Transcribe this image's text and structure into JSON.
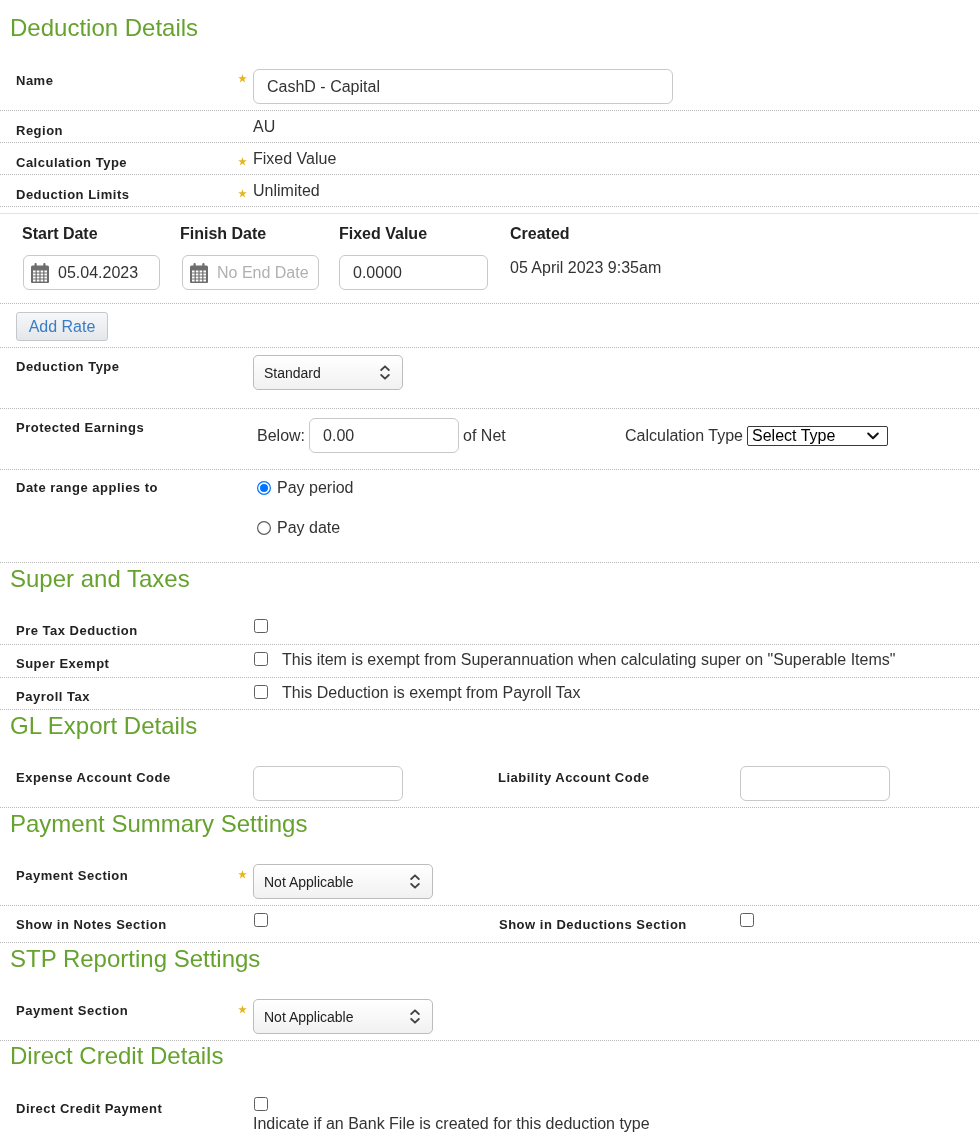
{
  "deduction_details": {
    "title": "Deduction Details",
    "fields": [
      {
        "label": "Name",
        "required": true,
        "kind": "input",
        "value": "CashD - Capital"
      },
      {
        "label": "Region",
        "required": false,
        "kind": "text",
        "value": "AU"
      },
      {
        "label": "Calculation Type",
        "required": true,
        "kind": "text",
        "value": "Fixed Value"
      },
      {
        "label": "Deduction Limits",
        "required": true,
        "kind": "text",
        "value": "Unlimited"
      }
    ],
    "rates": {
      "columns": [
        "Start Date",
        "Finish Date",
        "Fixed Value",
        "Created"
      ],
      "row": {
        "start_date": {
          "value": "05.04.2023"
        },
        "finish_date": {
          "placeholder": "No End Date"
        },
        "fixed_value": {
          "value": "0.0000"
        },
        "created": "05 April 2023 9:35am"
      }
    },
    "add_rate_button": "Add Rate",
    "deduction_type": {
      "label": "Deduction Type",
      "value": "Standard"
    },
    "protected_earnings": {
      "label": "Protected Earnings",
      "prefix": "Below:",
      "value": "0.00",
      "suffix": "of Net",
      "calculation_type": {
        "label": "Calculation Type",
        "value": "Select Type"
      }
    },
    "date_range": {
      "label": "Date range applies to",
      "options": [
        {
          "label": "Pay period",
          "selected": true
        },
        {
          "label": "Pay date",
          "selected": false
        }
      ]
    }
  },
  "super_and_taxes": {
    "title": "Super and Taxes",
    "items": [
      {
        "label": "Pre Tax Deduction",
        "checked": false
      },
      {
        "label": "Super Exempt",
        "checked": false,
        "description": "This item is exempt from Superannuation when calculating super on \"Superable Items\""
      },
      {
        "label": "Payroll Tax",
        "checked": false,
        "description": "This Deduction is exempt from Payroll Tax"
      }
    ]
  },
  "gl_export_details": {
    "title": "GL Export Details",
    "fields": [
      {
        "label": "Expense Account Code"
      },
      {
        "label": "Liability Account Code"
      }
    ]
  },
  "payment_summary_settings": {
    "title": "Payment Summary Settings",
    "payment_section": {
      "label": "Payment Section",
      "required": true,
      "value": "Not Applicable"
    },
    "checks": [
      {
        "label": "Show in Notes Section",
        "checked": false
      },
      {
        "label": "Show in Deductions Section",
        "checked": false
      }
    ]
  },
  "stp_reporting_settings": {
    "title": "STP Reporting Settings",
    "payment_section": {
      "label": "Payment Section",
      "required": true,
      "value": "Not Applicable"
    }
  },
  "direct_credit_details": {
    "title": "Direct Credit Details",
    "items": [
      {
        "label": "Direct Credit Payment",
        "checked": false,
        "description": "Indicate if an Bank File is created for this deduction type"
      }
    ]
  }
}
